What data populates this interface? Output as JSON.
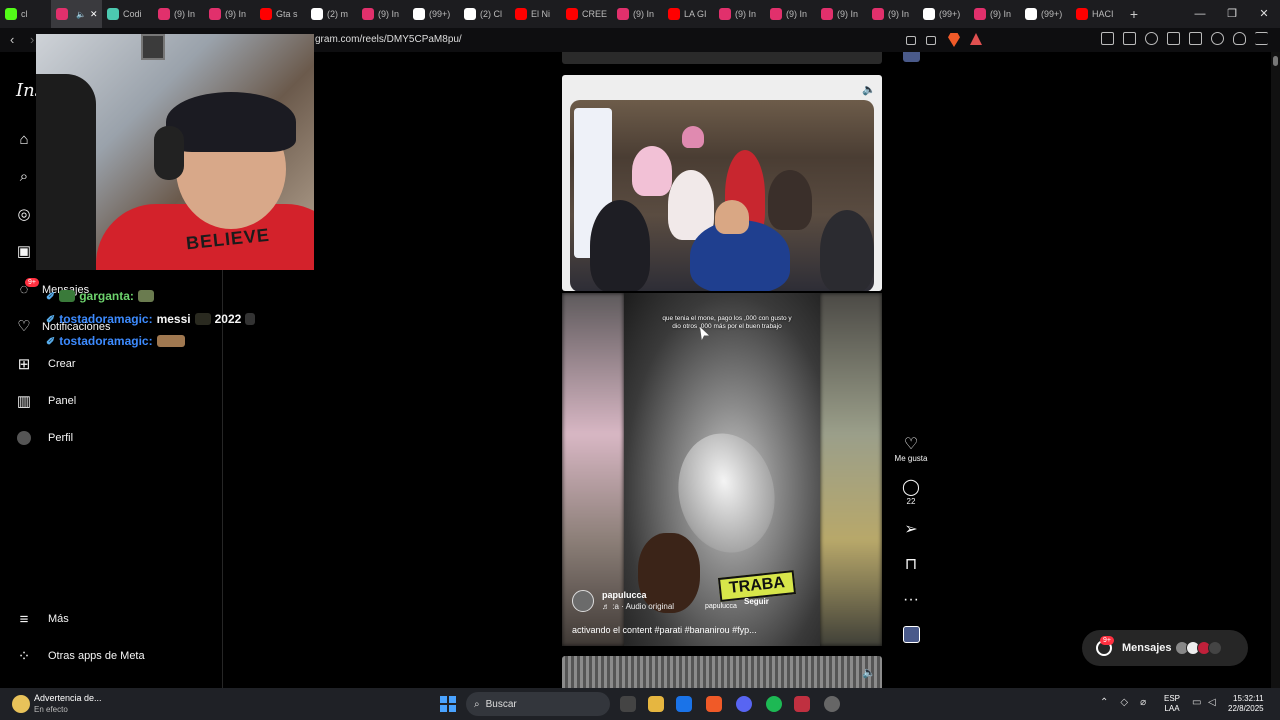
{
  "browser": {
    "tabs": [
      {
        "label": "cl",
        "color": "#53fc18",
        "active": false
      },
      {
        "label": "",
        "color": "#e1306c",
        "active": true
      },
      {
        "label": "Codi",
        "color": "#4cc9b0",
        "active": false
      },
      {
        "label": "(9) In",
        "color": "#e1306c",
        "active": false
      },
      {
        "label": "(9) In",
        "color": "#e1306c",
        "active": false
      },
      {
        "label": "Gta s",
        "color": "#ff0000",
        "active": false
      },
      {
        "label": "(2) m",
        "color": "#ffffff",
        "active": false
      },
      {
        "label": "(9) In",
        "color": "#e1306c",
        "active": false
      },
      {
        "label": "(99+)",
        "color": "#ffffff",
        "active": false
      },
      {
        "label": "(2) Cl",
        "color": "#ffffff",
        "active": false
      },
      {
        "label": "El Ni",
        "color": "#ff0000",
        "active": false
      },
      {
        "label": "CREE",
        "color": "#ff0000",
        "active": false
      },
      {
        "label": "(9) In",
        "color": "#e1306c",
        "active": false
      },
      {
        "label": "LA GI",
        "color": "#ff0000",
        "active": false
      },
      {
        "label": "(9) In",
        "color": "#e1306c",
        "active": false
      },
      {
        "label": "(9) In",
        "color": "#e1306c",
        "active": false
      },
      {
        "label": "(9) In",
        "color": "#e1306c",
        "active": false
      },
      {
        "label": "(9) In",
        "color": "#e1306c",
        "active": false
      },
      {
        "label": "(99+)",
        "color": "#ffffff",
        "active": false
      },
      {
        "label": "(9) In",
        "color": "#e1306c",
        "active": false
      },
      {
        "label": "(99+)",
        "color": "#ffffff",
        "active": false
      },
      {
        "label": "HACI",
        "color": "#ff0000",
        "active": false
      }
    ],
    "new_tab": "+",
    "url": "gram.com/reels/DMY5CPaM8pu/"
  },
  "sidebar": {
    "logo": "Ins",
    "items": [
      {
        "label": "",
        "icon": "home-icon"
      },
      {
        "label": "",
        "icon": "search-icon"
      },
      {
        "label": "",
        "icon": "explore-icon"
      },
      {
        "label": "",
        "icon": "reels-icon"
      },
      {
        "label": "Mensajes",
        "icon": "messenger-icon",
        "badge": "9+"
      },
      {
        "label": "Notificaciones",
        "icon": "heart-icon"
      },
      {
        "label": "Crear",
        "icon": "plus-icon"
      },
      {
        "label": "Panel",
        "icon": "chart-icon"
      },
      {
        "label": "Perfil",
        "icon": "avatar-icon"
      }
    ],
    "more": "Más",
    "meta_apps": "Otras apps de Meta"
  },
  "stream_chat": [
    {
      "user": "garganta:",
      "message": "",
      "user_color": "#6dd36d"
    },
    {
      "user": "tostadoramagic:",
      "message": "messi",
      "message_suffix": "2022",
      "user_color": "#3d8bff"
    },
    {
      "user": "tostadoramagic:",
      "message": "",
      "user_color": "#3d8bff"
    }
  ],
  "webcam": {
    "shirt_text": "BELIEVE"
  },
  "reel": {
    "caption_top": "que tenia el mone, pago los ,000 con gusto y dio otros ,000 más por el buen trabajo",
    "sticker": "TRABA",
    "username": "papulucca",
    "audio": "♬ :a · Audio original",
    "second_user": "papulucca",
    "follow": "Seguir",
    "description": "activando el content #parati #bananirou #fyp..."
  },
  "actions": {
    "like_label": "Me gusta",
    "comments_count": "22"
  },
  "messages_pill": {
    "label": "Mensajes",
    "badge": "9+"
  },
  "taskbar": {
    "weather_title": "Advertencia de...",
    "weather_sub": "En efecto",
    "search_placeholder": "Buscar",
    "lang1": "ESP",
    "lang2": "LAA",
    "time": "15:32:11",
    "date": "22/8/2025"
  }
}
